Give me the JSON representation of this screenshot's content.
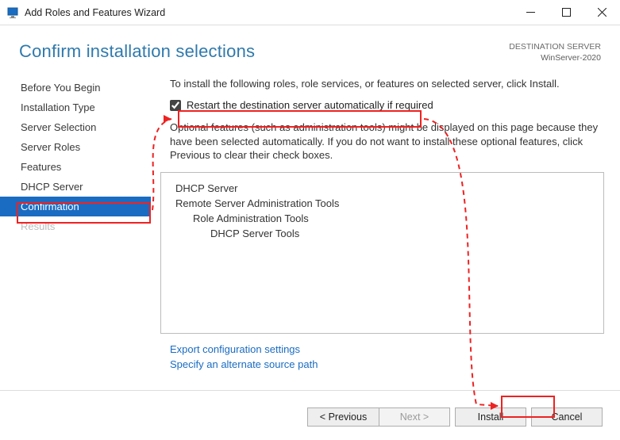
{
  "window": {
    "title": "Add Roles and Features Wizard"
  },
  "header": {
    "heading": "Confirm installation selections",
    "destination_label": "DESTINATION SERVER",
    "destination_server": "WinServer-2020"
  },
  "nav": {
    "items": [
      {
        "label": "Before You Begin",
        "state": "normal"
      },
      {
        "label": "Installation Type",
        "state": "normal"
      },
      {
        "label": "Server Selection",
        "state": "normal"
      },
      {
        "label": "Server Roles",
        "state": "normal"
      },
      {
        "label": "Features",
        "state": "normal"
      },
      {
        "label": "DHCP Server",
        "state": "normal"
      },
      {
        "label": "Confirmation",
        "state": "active"
      },
      {
        "label": "Results",
        "state": "disabled"
      }
    ]
  },
  "main": {
    "intro": "To install the following roles, role services, or features on selected server, click Install.",
    "restart_label": "Restart the destination server automatically if required",
    "restart_checked": true,
    "note": "Optional features (such as administration tools) might be displayed on this page because they have been selected automatically. If you do not want to install these optional features, click Previous to clear their check boxes.",
    "list": [
      {
        "text": "DHCP Server",
        "indent": 0
      },
      {
        "text": "Remote Server Administration Tools",
        "indent": 0
      },
      {
        "text": "Role Administration Tools",
        "indent": 1
      },
      {
        "text": "DHCP Server Tools",
        "indent": 2
      }
    ],
    "link_export": "Export configuration settings",
    "link_source": "Specify an alternate source path"
  },
  "footer": {
    "previous": "< Previous",
    "next": "Next >",
    "install": "Install",
    "cancel": "Cancel"
  },
  "icons": {
    "app_color": "#1a6cc2"
  }
}
